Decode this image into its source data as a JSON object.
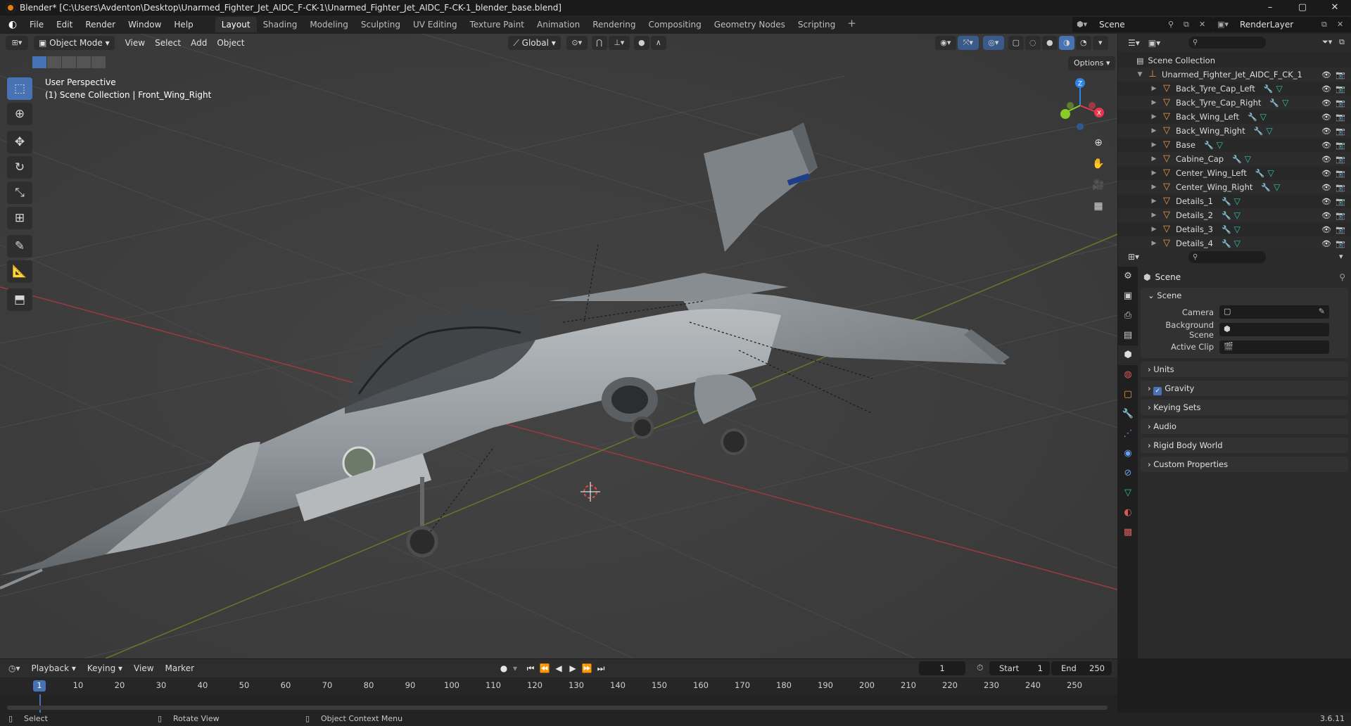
{
  "window": {
    "title": "Blender* [C:\\Users\\Avdenton\\Desktop\\Unarmed_Fighter_Jet_AIDC_F-CK-1\\Unarmed_Fighter_Jet_AIDC_F-CK-1_blender_base.blend]",
    "minimize": "–",
    "maximize": "▢",
    "close": "✕"
  },
  "menu": {
    "items": [
      "File",
      "Edit",
      "Render",
      "Window",
      "Help"
    ],
    "workspaces": [
      "Layout",
      "Shading",
      "Modeling",
      "Sculpting",
      "UV Editing",
      "Texture Paint",
      "Animation",
      "Rendering",
      "Compositing",
      "Geometry Nodes",
      "Scripting"
    ],
    "active_workspace": "Layout",
    "add": "+",
    "scene": "Scene",
    "render_layer": "RenderLayer"
  },
  "viewport": {
    "mode": "Object Mode",
    "menus": [
      "View",
      "Select",
      "Add",
      "Object"
    ],
    "orientation": "Global",
    "options": "Options",
    "perspective": "User Perspective",
    "context": "(1) Scene Collection | Front_Wing_Right",
    "gizmo": {
      "x": "X",
      "y": "Y",
      "z": "Z"
    }
  },
  "outliner": {
    "root": "Scene Collection",
    "collection": "Unarmed_Fighter_Jet_AIDC_F_CK_1",
    "objects": [
      "Back_Tyre_Cap_Left",
      "Back_Tyre_Cap_Right",
      "Back_Wing_Left",
      "Back_Wing_Right",
      "Base",
      "Cabine_Cap",
      "Center_Wing_Left",
      "Center_Wing_Right",
      "Details_1",
      "Details_2",
      "Details_3",
      "Details_4"
    ]
  },
  "properties": {
    "title": "Scene",
    "panel": "Scene",
    "fields": [
      {
        "label": "Camera",
        "value": ""
      },
      {
        "label": "Background Scene",
        "value": ""
      },
      {
        "label": "Active Clip",
        "value": ""
      }
    ],
    "sections": [
      "Units",
      "Gravity",
      "Keying Sets",
      "Audio",
      "Rigid Body World",
      "Custom Properties"
    ]
  },
  "timeline": {
    "menus": [
      "Playback",
      "Keying",
      "View",
      "Marker"
    ],
    "current_frame": "1",
    "start_label": "Start",
    "start": "1",
    "end_label": "End",
    "end": "250",
    "ticks": [
      "10",
      "20",
      "30",
      "40",
      "50",
      "60",
      "70",
      "80",
      "90",
      "100",
      "110",
      "120",
      "130",
      "140",
      "150",
      "160",
      "170",
      "180",
      "190",
      "200",
      "210",
      "220",
      "230",
      "240",
      "250"
    ]
  },
  "status": {
    "select": "Select",
    "rotate": "Rotate View",
    "context_menu": "Object Context Menu",
    "version": "3.6.11"
  },
  "colors": {
    "accent": "#4772b3",
    "x_axis": "#e8364f",
    "y_axis": "#8acb26",
    "z_axis": "#2f83e3",
    "object": "#e99a4a",
    "mesh": "#2fc3a4"
  }
}
